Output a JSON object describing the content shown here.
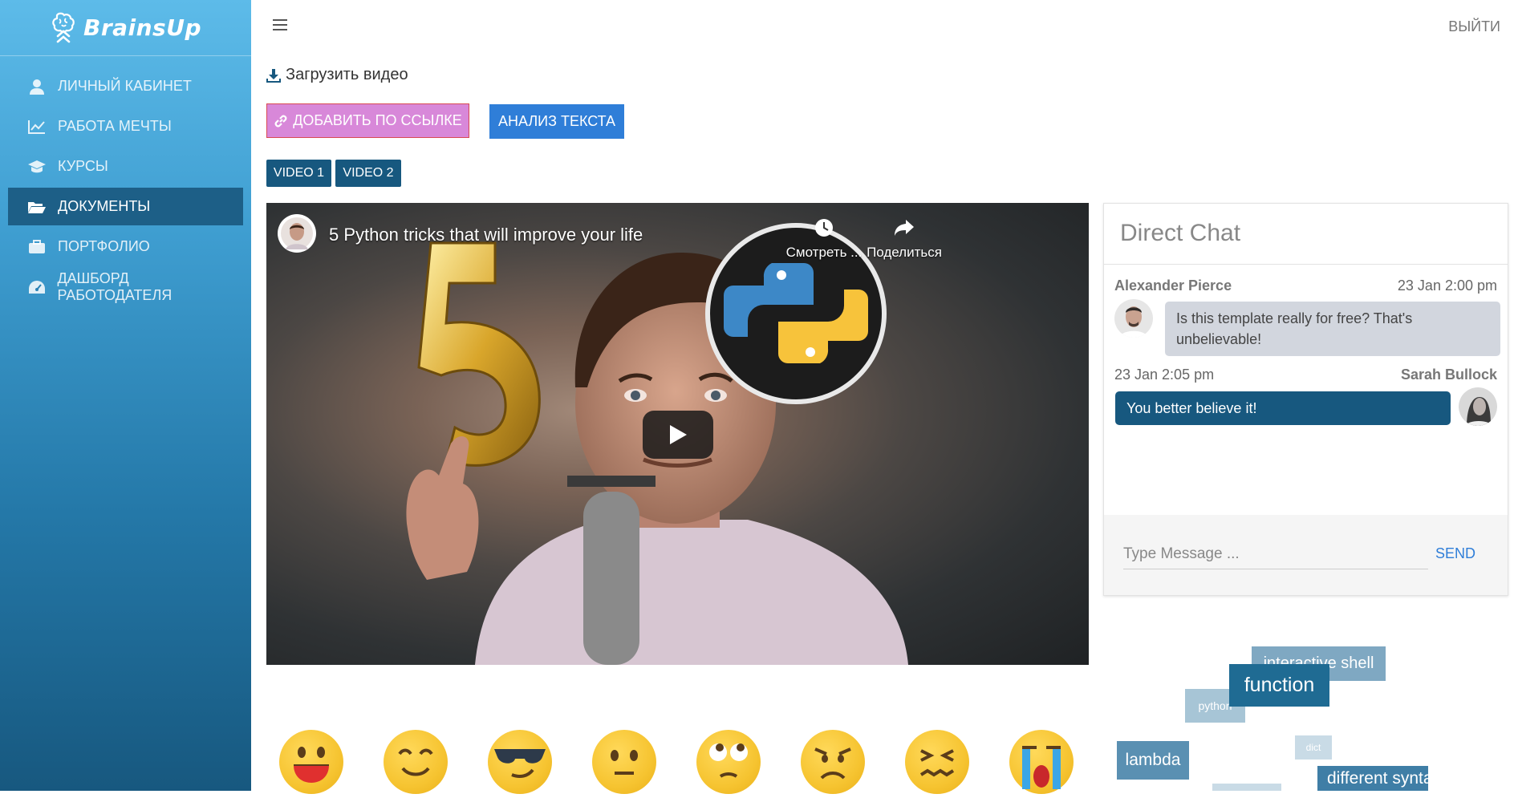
{
  "brand": {
    "name": "BrainsUp"
  },
  "sidebar": {
    "items": [
      {
        "label": "ЛИЧНЫЙ КАБИНЕТ",
        "icon": "user-icon"
      },
      {
        "label": "РАБОТА МЕЧТЫ",
        "icon": "line-chart-icon"
      },
      {
        "label": "КУРСЫ",
        "icon": "graduation-cap-icon"
      },
      {
        "label": "ДОКУМЕНТЫ",
        "icon": "folder-open-icon",
        "active": true
      },
      {
        "label": "ПОРТФОЛИО",
        "icon": "briefcase-icon"
      },
      {
        "label": "ДАШБОРД РАБОТОДАТЕЛЯ",
        "icon": "dashboard-icon"
      }
    ]
  },
  "header": {
    "logout_label": "ВЫЙТИ"
  },
  "upload": {
    "label": "Загрузить видео"
  },
  "actions": {
    "add_by_link": "ДОБАВИТЬ ПО ССЫЛКЕ",
    "text_analysis": "АНАЛИЗ ТЕКСТА"
  },
  "video_tabs": [
    "VIDEO 1",
    "VIDEO 2"
  ],
  "video": {
    "title": "5 Python tricks that will improve your life",
    "watch_later": "Смотреть ...",
    "share": "Поделиться"
  },
  "chat": {
    "title": "Direct Chat",
    "messages": [
      {
        "name": "Alexander Pierce",
        "time": "23 Jan 2:00 pm",
        "text": "Is this template really for free? That's unbelievable!"
      },
      {
        "name": "Sarah Bullock",
        "time": "23 Jan 2:05 pm",
        "text": "You better believe it!"
      }
    ],
    "input_placeholder": "Type Message ...",
    "send_label": "SEND"
  },
  "emotions": [
    "happy-face-icon",
    "smiling-face-icon",
    "cool-face-icon",
    "neutral-face-icon",
    "eye-roll-face-icon",
    "angry-face-icon",
    "disgusted-face-icon",
    "crying-face-icon"
  ],
  "word_cloud": [
    "interactive shell",
    "function",
    "python",
    "lambda",
    "dict",
    "different syntax"
  ],
  "colors": {
    "sidebar_active": "#17587f",
    "accent_blue": "#2f7ed8",
    "link_button": "#d888d9",
    "chat_bubble_in": "#d2d6de"
  }
}
